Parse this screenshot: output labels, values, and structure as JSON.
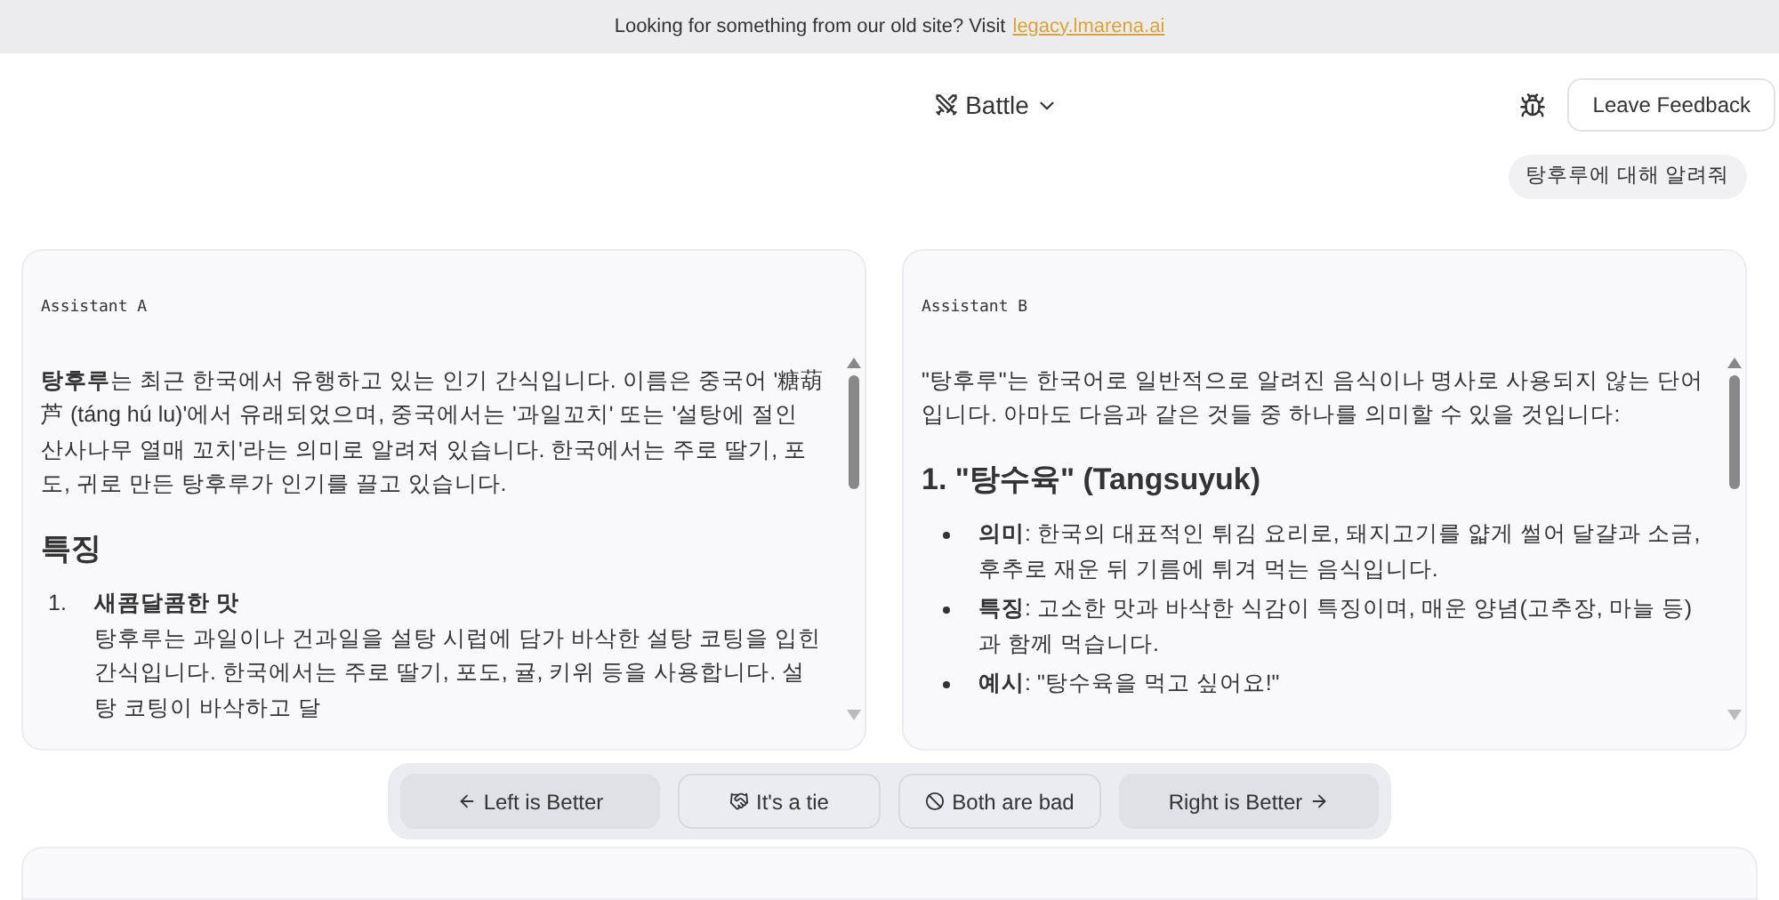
{
  "banner": {
    "text": "Looking for something from our old site? Visit",
    "link": "legacy.lmarena.ai"
  },
  "header": {
    "mode": "Battle",
    "feedback_button": "Leave Feedback"
  },
  "user_message": "탕후루에 대해 알려줘",
  "panels": [
    {
      "label": "Assistant A",
      "blocks": [
        {
          "kind": "paragraph",
          "text": "**탕후루**는 최근 한국에서 유행하고 있는 인기 간식입니다. 이름은 중국어 '糖葫芦 (táng hú lu)'에서 유래되었으며, 중국에서는 '과일꼬치' 또는 '설탕에 절인 산사나무 열매 꼬치'라는 의미로 알려져 있습니다. 한국에서는 주로 딸기, 포도, 귀로 만든 탕후루가 인기를 끌고 있습니다."
        },
        {
          "kind": "heading",
          "text": "특징"
        },
        {
          "kind": "ordered",
          "items": [
            {
              "number": "1.",
              "title": "새콤달콤한 맛",
              "text": "탕후루는 과일이나 건과일을 설탕 시럽에 담가 바삭한 설탕 코팅을 입힌 간식입니다. 한국에서는 주로 딸기, 포도, 귤, 키위 등을 사용합니다. 설탕 코팅이 바삭하고 달"
            }
          ]
        }
      ]
    },
    {
      "label": "Assistant B",
      "blocks": [
        {
          "kind": "paragraph",
          "text": "\"탕후루\"는 한국어로 일반적으로 알려진 음식이나 명사로 사용되지 않는 단어입니다. 아마도 다음과 같은 것들 중 하나를 의미할 수 있을 것입니다:"
        },
        {
          "kind": "heading",
          "text": "1. \"탕수육\" (Tangsuyuk)"
        },
        {
          "kind": "bullets",
          "items": [
            {
              "text": "**의미**: 한국의 대표적인 튀김 요리로, 돼지고기를 얇게 썰어 달걀과 소금, 후추로 재운 뒤 기름에 튀겨 먹는 음식입니다."
            },
            {
              "text": "**특징**: 고소한 맛과 바삭한 식감이 특징이며, 매운 양념(고추장, 마늘 등)과 함께 먹습니다."
            },
            {
              "text": "**예시**: \"탕수육을 먹고 싶어요!\""
            }
          ]
        }
      ]
    }
  ],
  "vote_buttons": [
    {
      "kind": "left",
      "label": "Left is Better"
    },
    {
      "kind": "tie",
      "label": "It's a tie"
    },
    {
      "kind": "bad",
      "label": "Both are bad"
    },
    {
      "kind": "right",
      "label": "Right is Better"
    }
  ]
}
